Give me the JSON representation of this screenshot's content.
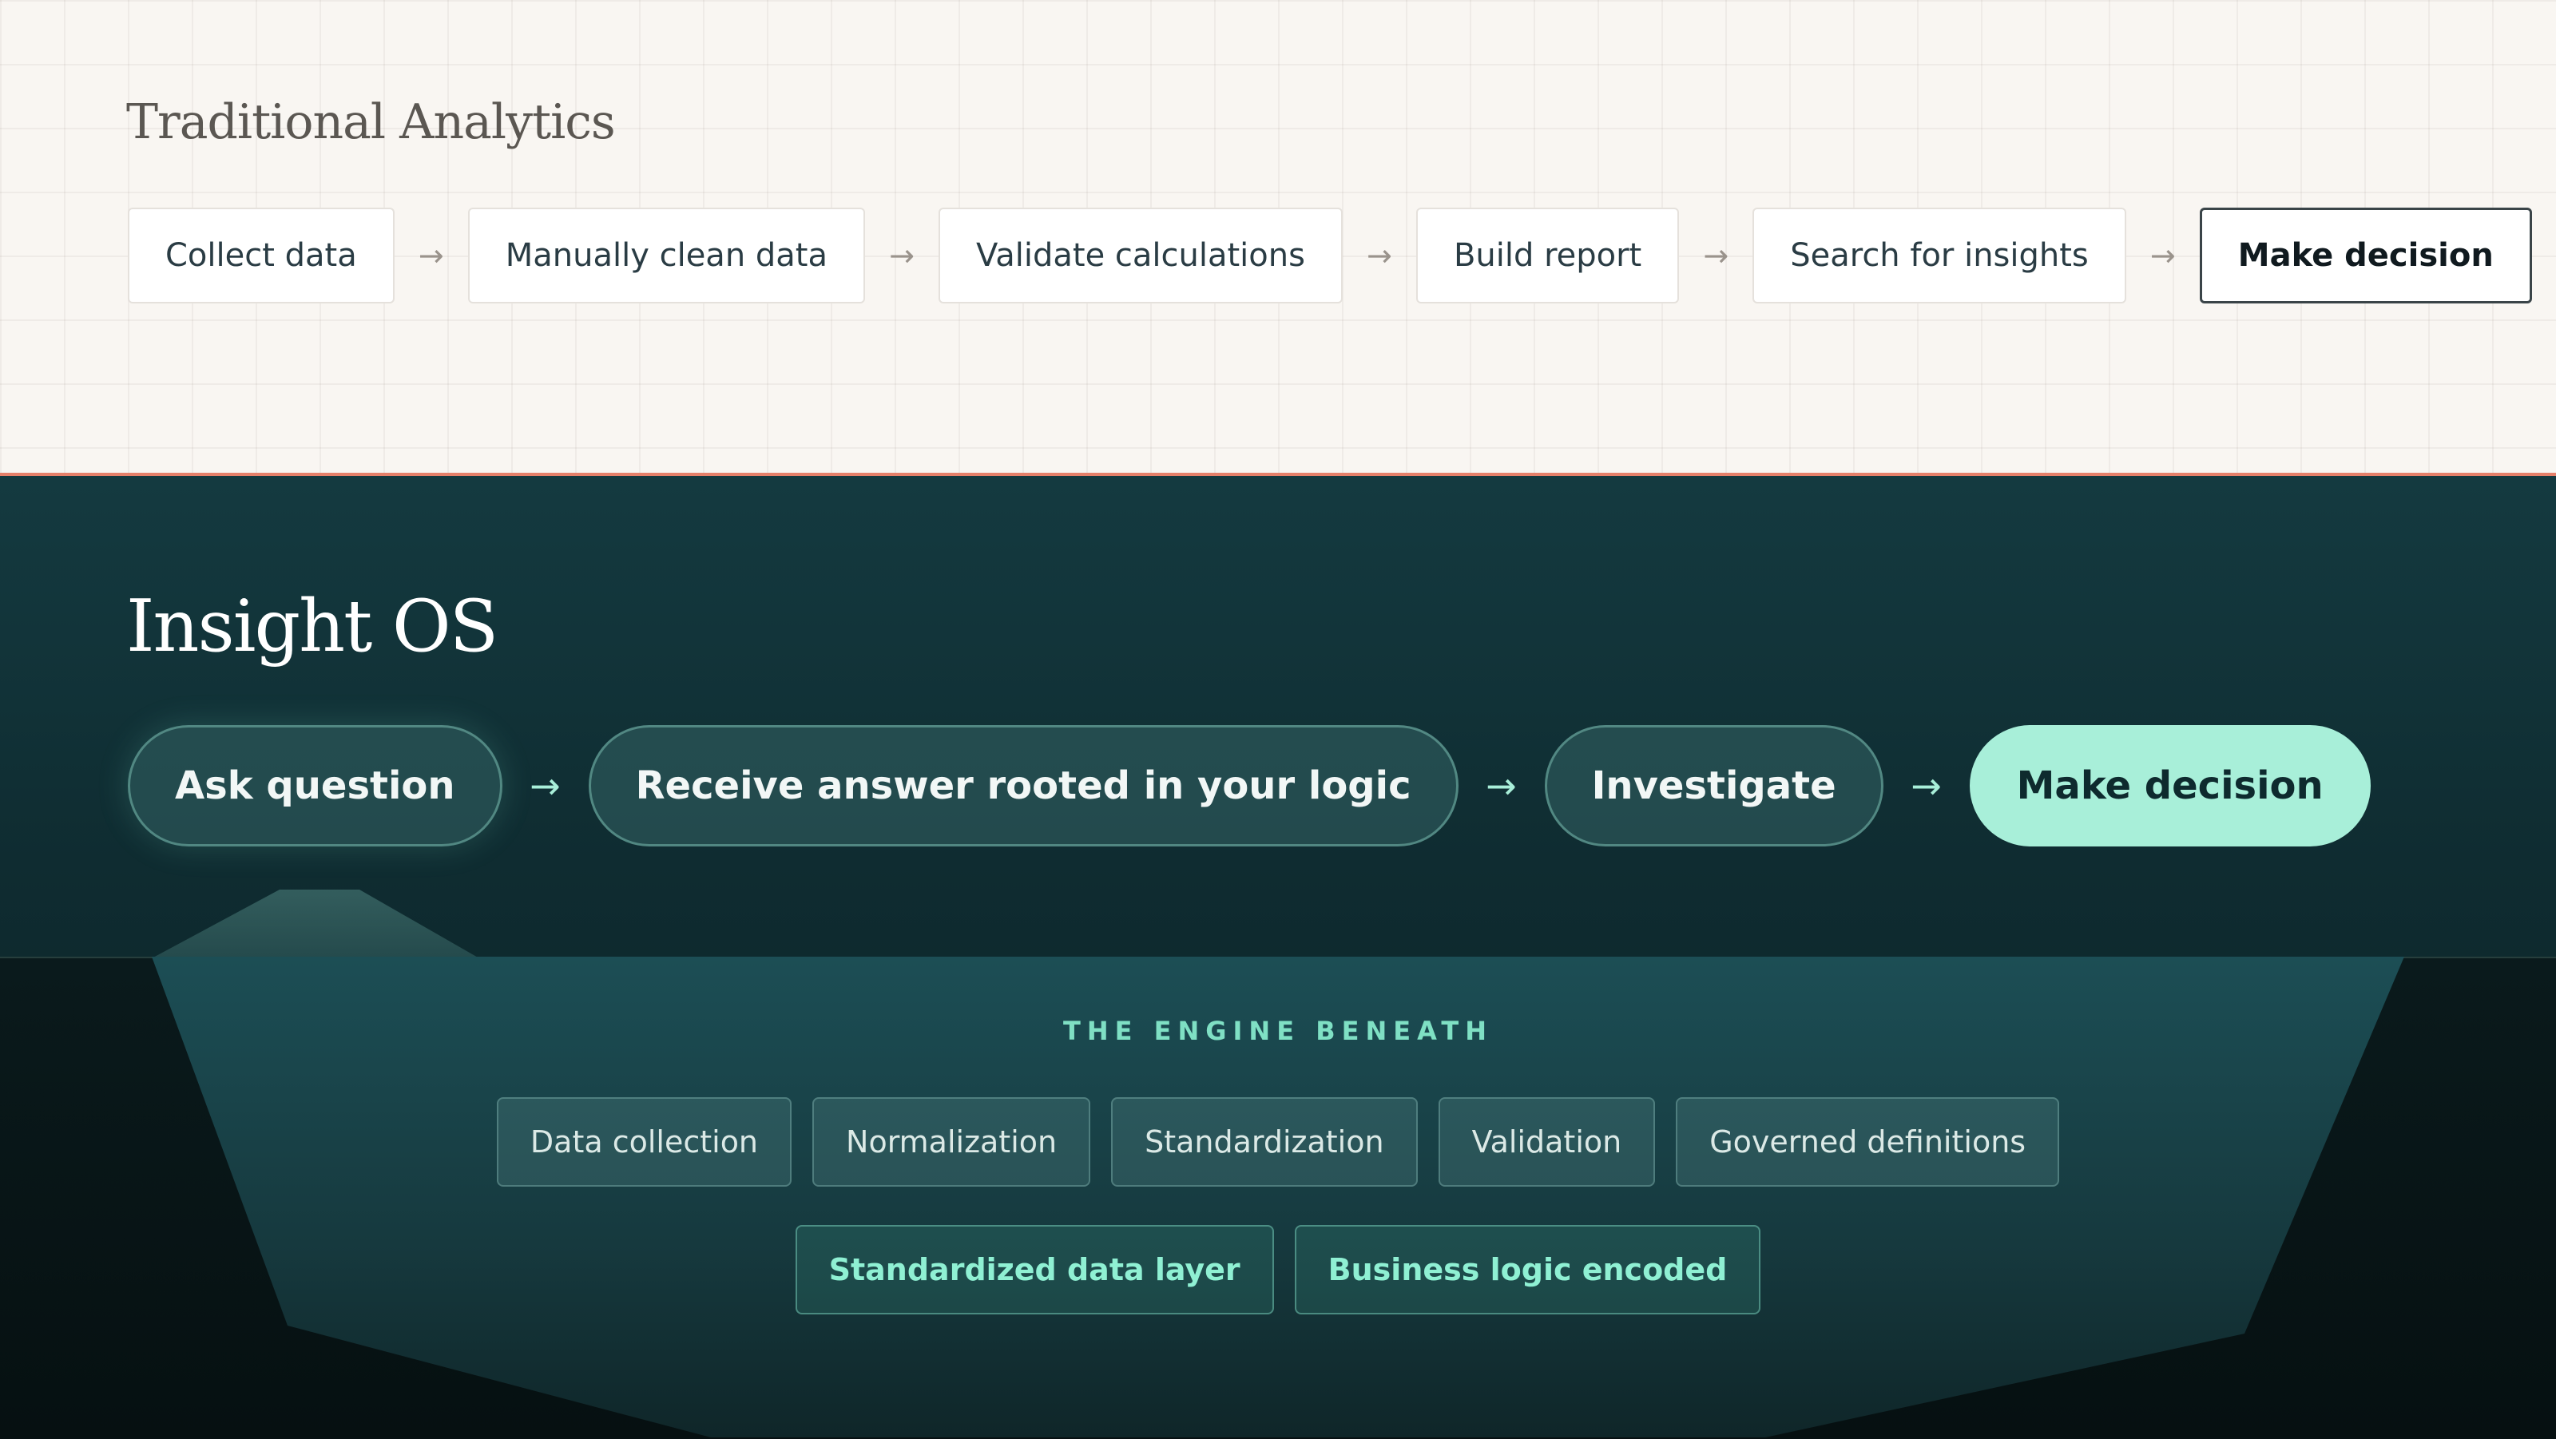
{
  "traditional": {
    "title": "Traditional Analytics",
    "steps": [
      "Collect data",
      "Manually clean data",
      "Validate calculations",
      "Build report",
      "Search for insights",
      "Make decision"
    ],
    "arrow": "→"
  },
  "insight_os": {
    "title": "Insight OS",
    "steps": [
      "Ask question",
      "Receive answer rooted in your logic",
      "Investigate",
      "Make decision"
    ],
    "arrow": "→"
  },
  "engine": {
    "label": "THE ENGINE BENEATH",
    "components": [
      "Data collection",
      "Normalization",
      "Standardization",
      "Validation",
      "Governed definitions"
    ],
    "outputs": [
      "Standardized data layer",
      "Business logic encoded"
    ]
  },
  "colors": {
    "accent_mint": "#a8efd9",
    "top_background": "#f9f6f2",
    "divider_coral": "#e6806a",
    "dark_teal": "#0f2c31"
  }
}
